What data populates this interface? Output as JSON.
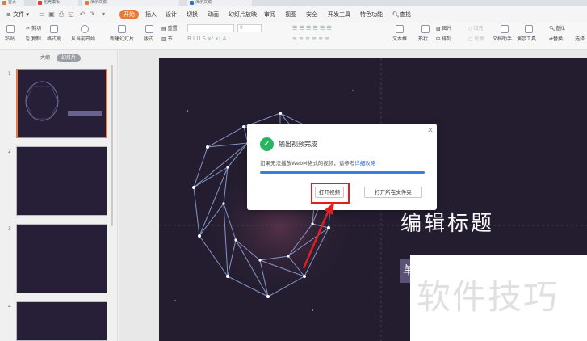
{
  "title_tabs": [
    {
      "label": "首页",
      "color": "#e8793a"
    },
    {
      "label": "稻壳模板",
      "color": "#e03c3c"
    },
    {
      "label": "演示文稿",
      "color": "#e8793a"
    },
    {
      "label": "演示文稿",
      "color": "#2a6fd6"
    }
  ],
  "menu": {
    "file": "文件",
    "items": [
      "开始",
      "插入",
      "设计",
      "切换",
      "动画",
      "幻灯片放映",
      "审阅",
      "视图",
      "安全",
      "开发工具",
      "特色功能"
    ],
    "search": "查找"
  },
  "toolbar": {
    "paste": "粘贴",
    "cut": "剪切",
    "copy": "复制",
    "format_painter": "格式刷",
    "from_current": "从当前开始",
    "new_slide": "新建幻灯片",
    "layout": "版式",
    "reset": "重置",
    "section": "节",
    "font_size": "0",
    "textbox": "文本框",
    "shape": "形状",
    "arrange": "排列",
    "picture": "图片",
    "fill": "填充",
    "outline": "轮廓",
    "doc_helper": "文档助手",
    "presenter": "演示工具",
    "find": "查找",
    "replace": "替换",
    "select": "选择"
  },
  "left_panel": {
    "tab_outline": "大纲",
    "tab_slides": "幻灯片",
    "slide_numbers": [
      "1",
      "2",
      "3",
      "4"
    ]
  },
  "slide": {
    "title": "编辑标题",
    "small_box_char": "单"
  },
  "dialog": {
    "title": "输出视频完成",
    "message": "如果无法播放WebM格式的视频，请参考",
    "link": "详细攻略",
    "open_video": "打开视频",
    "open_folder": "打开所在文件夹",
    "progress": 1.0
  },
  "watermark": "软件技巧",
  "colors": {
    "accent": "#e8793a",
    "slide_bg": "#241d30",
    "success": "#28b463",
    "highlight": "#e02020",
    "progress": "#3b7ddd"
  }
}
